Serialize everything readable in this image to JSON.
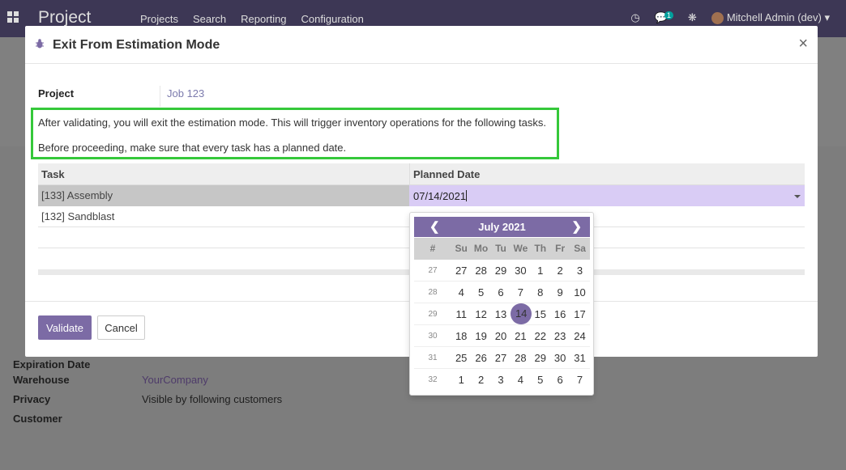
{
  "navbar": {
    "brand": "Project",
    "menu": [
      "Projects",
      "Search",
      "Reporting",
      "Configuration"
    ],
    "chat_badge": "1",
    "user": "Mitchell Admin (dev)"
  },
  "background": {
    "fields": [
      {
        "label": "Expiration Date",
        "value": ""
      },
      {
        "label": "Warehouse",
        "value": "YourCompany"
      },
      {
        "label": "Privacy",
        "value": "Visible by following customers"
      },
      {
        "label": "Customer",
        "value": ""
      }
    ]
  },
  "modal": {
    "title": "Exit From Estimation Mode",
    "close": "×",
    "project_label": "Project",
    "project_value": "Job 123",
    "notice_line1": "After validating, you will exit the estimation mode. This will trigger inventory operations for the following tasks.",
    "notice_line2": "Before proceeding, make sure that every task has a planned date.",
    "table": {
      "headers": [
        "Task",
        "Planned Date"
      ],
      "rows": [
        {
          "task": "[133] Assembly",
          "planned_date": "07/14/2021"
        },
        {
          "task": "[132] Sandblast",
          "planned_date": ""
        }
      ]
    },
    "validate_label": "Validate",
    "cancel_label": "Cancel"
  },
  "datepicker": {
    "month": "July 2021",
    "week_header": "#",
    "days": [
      "Su",
      "Mo",
      "Tu",
      "We",
      "Th",
      "Fr",
      "Sa"
    ],
    "weeks": [
      {
        "num": "27",
        "days": [
          "27",
          "28",
          "29",
          "30",
          "1",
          "2",
          "3"
        ]
      },
      {
        "num": "28",
        "days": [
          "4",
          "5",
          "6",
          "7",
          "8",
          "9",
          "10"
        ]
      },
      {
        "num": "29",
        "days": [
          "11",
          "12",
          "13",
          "14",
          "15",
          "16",
          "17"
        ]
      },
      {
        "num": "30",
        "days": [
          "18",
          "19",
          "20",
          "21",
          "22",
          "23",
          "24"
        ]
      },
      {
        "num": "31",
        "days": [
          "25",
          "26",
          "27",
          "28",
          "29",
          "30",
          "31"
        ]
      },
      {
        "num": "32",
        "days": [
          "1",
          "2",
          "3",
          "4",
          "5",
          "6",
          "7"
        ]
      }
    ],
    "selected": "14",
    "accent": "#7c6ba5"
  }
}
